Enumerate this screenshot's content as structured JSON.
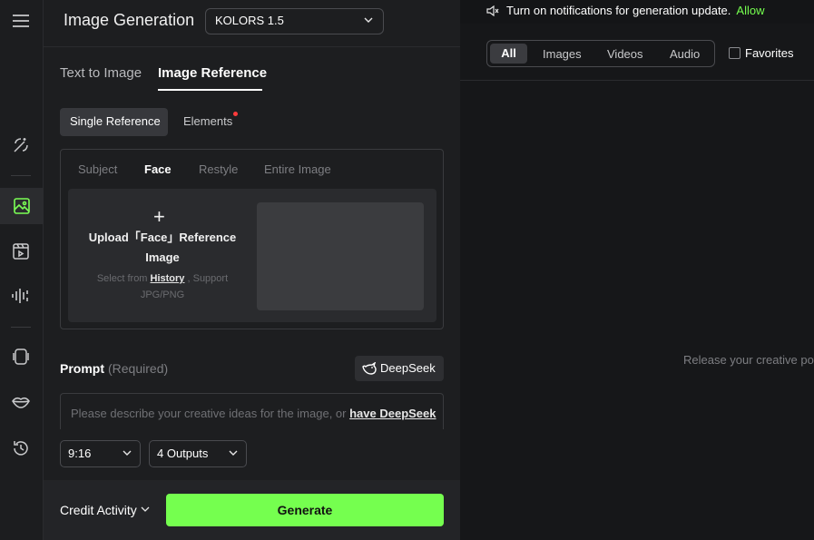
{
  "colors": {
    "accent": "#75ff4f",
    "notice_dot": "#ff3b3b"
  },
  "rail": {
    "icons": [
      "menu-icon",
      "magic-wand-icon",
      "image-icon",
      "video-icon",
      "audio-wave-icon",
      "canvas-icon",
      "lips-icon",
      "history-icon"
    ],
    "active": "image-icon"
  },
  "header": {
    "title": "Image Generation",
    "model": "KOLORS 1.5"
  },
  "mode_tabs": [
    {
      "label": "Text to Image",
      "active": false
    },
    {
      "label": "Image Reference",
      "active": true
    }
  ],
  "sub_tabs": {
    "single": "Single Reference",
    "elements": "Elements"
  },
  "ref_tabs": [
    "Subject",
    "Face",
    "Restyle",
    "Entire Image"
  ],
  "ref_active": "Face",
  "upload": {
    "title": "Upload「Face」Reference Image",
    "hint_before": "Select from ",
    "history": "History",
    "hint_after": " , Support JPG/PNG"
  },
  "prompt": {
    "label": "Prompt",
    "required": "(Required)",
    "deepseek": "DeepSeek",
    "placeholder": "Please describe your creative ideas for the image, or ",
    "placeholder_link": "have DeepSeek"
  },
  "options": {
    "ratio": "9:16",
    "outputs": "4 Outputs"
  },
  "footer": {
    "credit": "Credit Activity",
    "generate": "Generate"
  },
  "notification": {
    "text": "Turn on notifications for generation update.",
    "allow": "Allow"
  },
  "filters": [
    "All",
    "Images",
    "Videos",
    "Audio"
  ],
  "filter_active": "All",
  "favorites": "Favorites",
  "empty_message": "Release your creative pot"
}
